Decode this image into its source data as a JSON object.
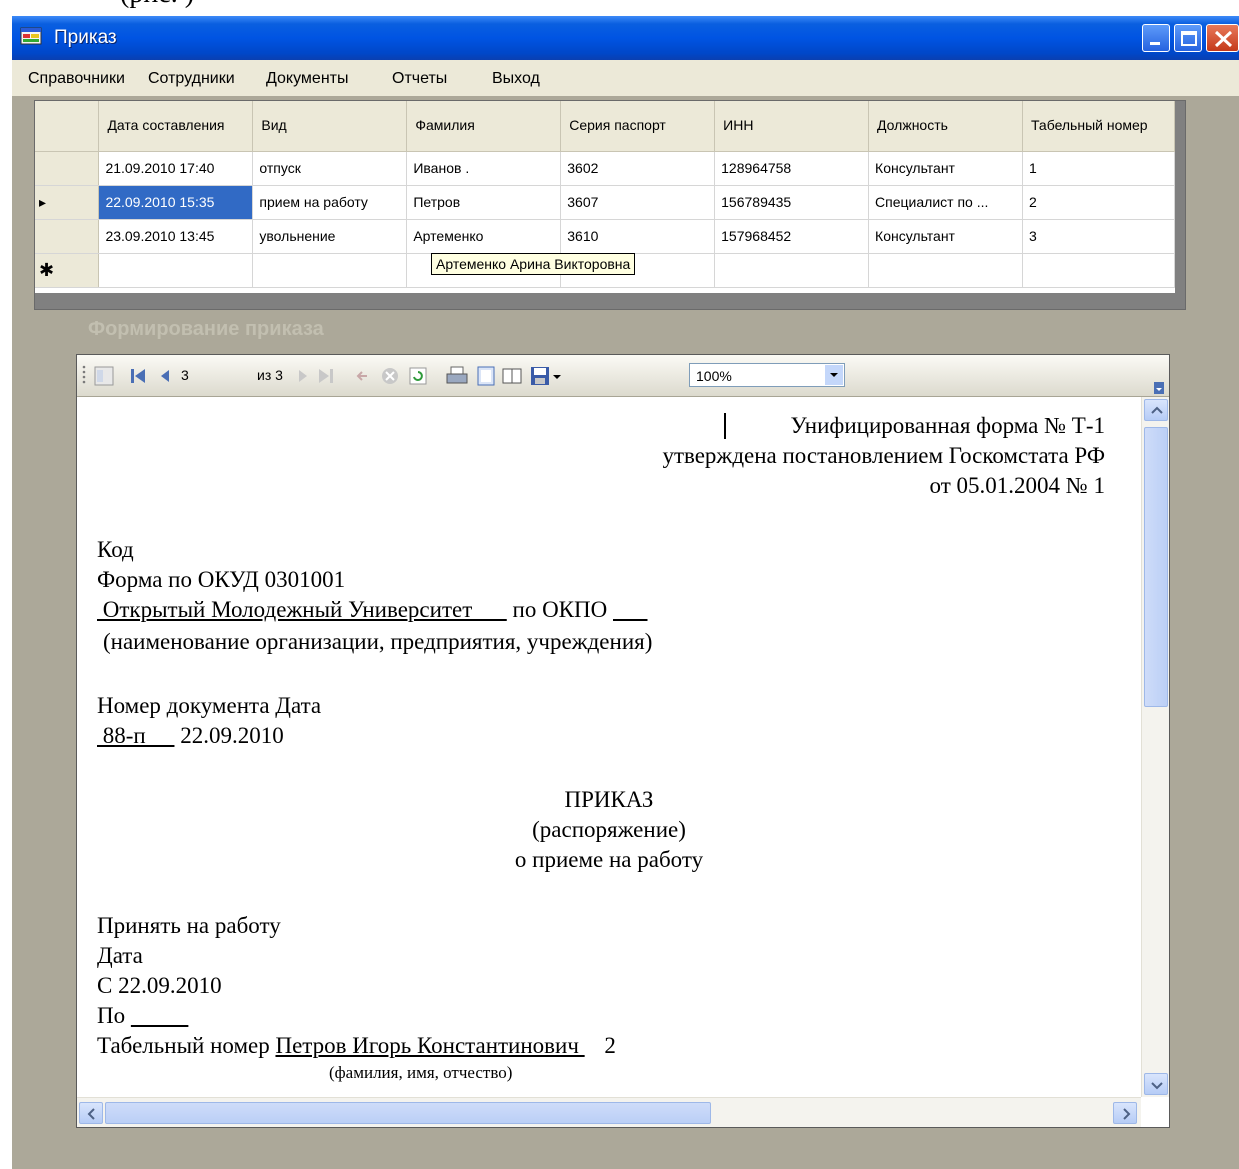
{
  "doc_crop": "(рис. )",
  "window": {
    "title": "Приказ"
  },
  "menu": [
    "Справочники",
    "Сотрудники",
    "Документы",
    "Отчеты",
    "Выход"
  ],
  "grid": {
    "columns": [
      "Дата составления",
      "Вид",
      "Фамилия",
      "Серия паспорт",
      "ИНН",
      "Должность",
      "Табельный номер"
    ],
    "rows": [
      {
        "marker": "",
        "cells": [
          "21.09.2010 17:40",
          "отпуск",
          "Иванов .",
          "3602",
          "128964758",
          "Консультант",
          "1"
        ]
      },
      {
        "marker": "▸",
        "cells": [
          "22.09.2010 15:35",
          "прием на работу",
          "Петров",
          "3607",
          "156789435",
          "Специалист по ...",
          "2"
        ]
      },
      {
        "marker": "",
        "cells": [
          "23.09.2010 13:45",
          "увольнение",
          "Артеменко",
          "3610",
          "157968452",
          "Консультант",
          "3"
        ]
      },
      {
        "marker": "✱",
        "cells": [
          "",
          "",
          "",
          "",
          "",
          "",
          ""
        ]
      }
    ],
    "tooltip": "Артеменко Арина Викторовна"
  },
  "group_label": "Формирование приказа",
  "viewer": {
    "page_current": "3",
    "page_of": "из 3",
    "zoom": "100%"
  },
  "report": {
    "header1": "Унифицированная форма № Т-1",
    "header2": "утверждена постановлением Госкомстата РФ",
    "header3": "от 05.01.2004 № 1",
    "kod": "Код",
    "okud": "Форма по ОКУД 0301001",
    "org_name": " Открытый Молодежный Университет      ",
    "okpo": "по ОКПО",
    "okpo_blank": "      ",
    "org_caption": "(наименование организации, предприятия, учреждения)",
    "doc_header": "Номер документа Дата",
    "doc_number": " 88-п     ",
    "doc_date": "22.09.2010",
    "title": "ПРИКАЗ",
    "subtitle": "(распоряжение)",
    "about": "о приеме на работу",
    "hire": "Принять на работу",
    "date_label": "Дата",
    "from_date": "С 22.09.2010",
    "to_label": "По",
    "to_blank": "          ",
    "tab_label": "Табельный номер",
    "employee_name": "Петров Игорь Константинович ",
    "tab_number": "2",
    "name_caption": "(фамилия, имя, отчество)"
  }
}
